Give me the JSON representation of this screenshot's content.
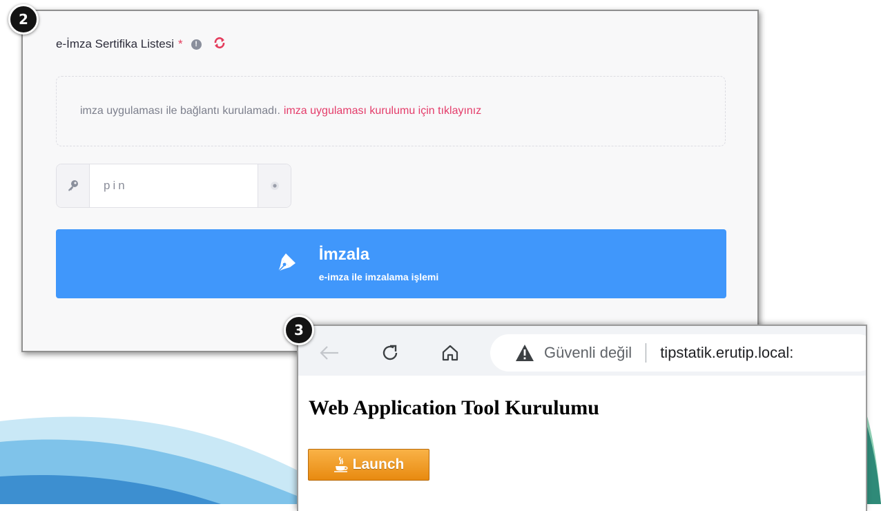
{
  "badges": {
    "step2": "2",
    "step3": "3"
  },
  "signing_panel": {
    "certificate_label": "e-İmza Sertifika Listesi",
    "required_mark": "*",
    "info_glyph": "!",
    "notice_text": "imza uygulaması ile bağlantı kurulamadı.",
    "notice_link": "imza uygulaması kurulumu için tıklayınız",
    "pin_placeholder": "pin",
    "sign_button": {
      "title": "İmzala",
      "subtitle": "e-imza ile imzalama işlemi"
    },
    "colors": {
      "accent_red": "#e43c5c",
      "button_blue": "#4097fb"
    }
  },
  "browser": {
    "security_warning": "Güvenli değil",
    "url": "tipstatik.erutip.local:",
    "page_heading": "Web Application Tool Kurulumu",
    "launch_button": "Launch",
    "icons": [
      "back-arrow-icon",
      "reload-icon",
      "home-icon",
      "warning-triangle-icon",
      "java-cup-icon"
    ]
  }
}
